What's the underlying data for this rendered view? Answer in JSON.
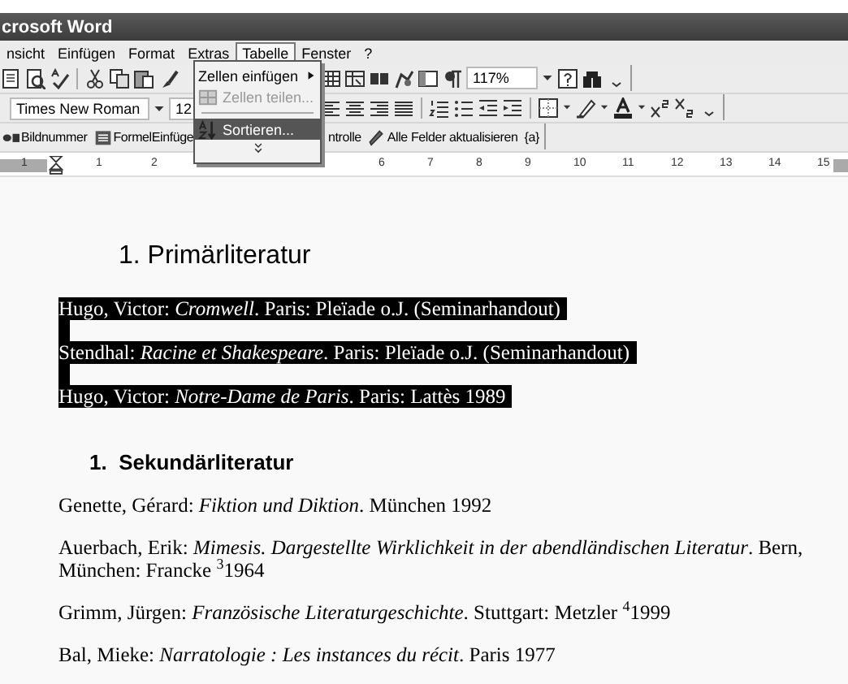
{
  "window": {
    "title": "crosoft Word"
  },
  "menu_bar": [
    {
      "label": "nsicht",
      "selected": false
    },
    {
      "label": "Einfügen",
      "selected": false
    },
    {
      "label": "Format",
      "selected": false
    },
    {
      "label": "Extras",
      "selected": false
    },
    {
      "label": "Tabelle",
      "selected": true
    },
    {
      "label": "Fenster",
      "selected": false
    },
    {
      "label": "?",
      "selected": false
    }
  ],
  "dropdown": {
    "items": [
      {
        "kind": "submenu",
        "label": "Zellen einfügen",
        "disabled": false,
        "selected": false
      },
      {
        "kind": "command",
        "label": "Zellen teilen...",
        "disabled": true,
        "selected": false
      },
      {
        "kind": "separator"
      },
      {
        "kind": "command",
        "label": "Sortieren...",
        "disabled": false,
        "selected": true
      },
      {
        "kind": "expand"
      }
    ]
  },
  "standard_toolbar": {
    "zoom": "117%"
  },
  "formatting_toolbar": {
    "font": "Times New Roman",
    "size": "12"
  },
  "fields_toolbar": {
    "left_buttons": [
      "Bildnummer",
      "FormelEinfüge"
    ],
    "right_buttons": [
      "ntrolle",
      "Alle Felder aktualisieren",
      "{a}"
    ]
  },
  "ruler": {
    "left_numbers": [
      "1",
      "1",
      "2"
    ],
    "right_numbers": [
      "6",
      "7",
      "8",
      "9",
      "10",
      "11",
      "12",
      "13",
      "14",
      "15"
    ]
  },
  "document": {
    "sections": [
      {
        "heading": "1. Primärliteratur",
        "kind": "major",
        "entries": [
          {
            "text": "Hugo, Victor: *Cromwell*. Paris: Pleïade o.J. (Seminarhandout)",
            "selected": true
          },
          {
            "text": "Stendhal: *Racine et Shakespeare*. Paris: Pleïade o.J. (Seminarhandout)",
            "selected": true
          },
          {
            "text": "Hugo, Victor: *Notre-Dame de Paris*. Paris: Lattès 1989",
            "selected": true
          }
        ]
      },
      {
        "heading": "1.  Sekundärliteratur",
        "kind": "minor",
        "entries": [
          {
            "text": "Genette, Gérard: *Fiktion und Diktion*. München 1992",
            "selected": false
          },
          {
            "text": "Auerbach, Erik: *Mimesis. Dargestellte Wirklichkeit in der abendländischen Literatur*. Bern, München: Francke $^{3}$1964",
            "selected": false
          },
          {
            "text": "Grimm, Jürgen: *Französische Literaturgeschichte*. Stuttgart: Metzler $^{4}$1999",
            "selected": false
          },
          {
            "text": "Bal, Mieke: *Narratologie : Les instances du récit*. Paris 1977",
            "selected": false
          }
        ]
      }
    ]
  }
}
